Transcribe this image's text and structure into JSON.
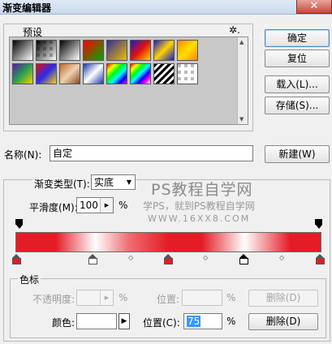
{
  "window": {
    "title": "渐变编辑器",
    "close_glyph": "✕"
  },
  "presets": {
    "label": "预设",
    "menu_glyph": "✲.",
    "items": [
      {
        "style": "linear-gradient(135deg,#000,#fff)"
      },
      {
        "style": "linear-gradient(135deg,#000,rgba(0,0,0,0))",
        "checker": true
      },
      {
        "style": "linear-gradient(135deg,#000,#fff)"
      },
      {
        "style": "linear-gradient(135deg,#f00,#0a0)"
      },
      {
        "style": "linear-gradient(135deg,#3a2a9a,#e8c000)"
      },
      {
        "style": "linear-gradient(135deg,#1a1acc,#e01010,#ffd400)"
      },
      {
        "style": "linear-gradient(135deg,#1a1acc,#ffd400,#1a1acc)"
      },
      {
        "style": "linear-gradient(135deg,#ff8800,#ffe000,#ff8800)"
      },
      {
        "style": "linear-gradient(135deg,#5a1aa8,#2aa050,#f0d000)"
      },
      {
        "style": "linear-gradient(135deg,#e01010,#2a2aee,#ffd400)"
      },
      {
        "style": "linear-gradient(135deg,#c46a2a,#f0d0b0,#8a4a2a)"
      },
      {
        "style": "linear-gradient(135deg,#1a3aa8,#ffffff,#1a3aa8)"
      },
      {
        "style": "linear-gradient(135deg,#f00,#ff0,#0f0,#0ff,#00f,#f0f)"
      },
      {
        "style": "linear-gradient(135deg,#f00,#ff0,#0f0,#0ff,#00f,#f0f,#fff)"
      },
      {
        "style": "repeating-linear-gradient(135deg,#000 0 3px,#fff 3px 6px)"
      },
      {
        "style": "linear-gradient(135deg,rgba(0,0,0,0),rgba(0,0,0,0))",
        "checker": true
      }
    ]
  },
  "buttons": {
    "ok": "确定",
    "reset": "复位",
    "load": "载入(L)...",
    "save": "存储(S)...",
    "new": "新建(W)",
    "delete_opacity": "删除(D)",
    "delete_color": "删除(D)"
  },
  "name": {
    "label": "名称(N):",
    "value": "自定"
  },
  "gradient": {
    "type_label": "渐变类型(T):",
    "type_value": "实底",
    "smoothness_label": "平滑度(M):",
    "smoothness_value": "100",
    "smoothness_unit": "%"
  },
  "watermark": {
    "line1": "PS教程自学网",
    "line2": "学PS，就到PS教程自学网",
    "line3": "WWW.16XX8.COM"
  },
  "stops": {
    "label": "色标",
    "opacity_label": "不透明度:",
    "opacity_unit": "%",
    "opacity_location_label": "位置:",
    "opacity_location_unit": "%",
    "color_label": "颜色:",
    "color_location_label": "位置(C):",
    "color_location_value": "75",
    "color_location_unit": "%",
    "selected_color": "#ffffff"
  },
  "colors": {
    "red_stop": "#e21d26",
    "white_stop": "#ffffff"
  }
}
